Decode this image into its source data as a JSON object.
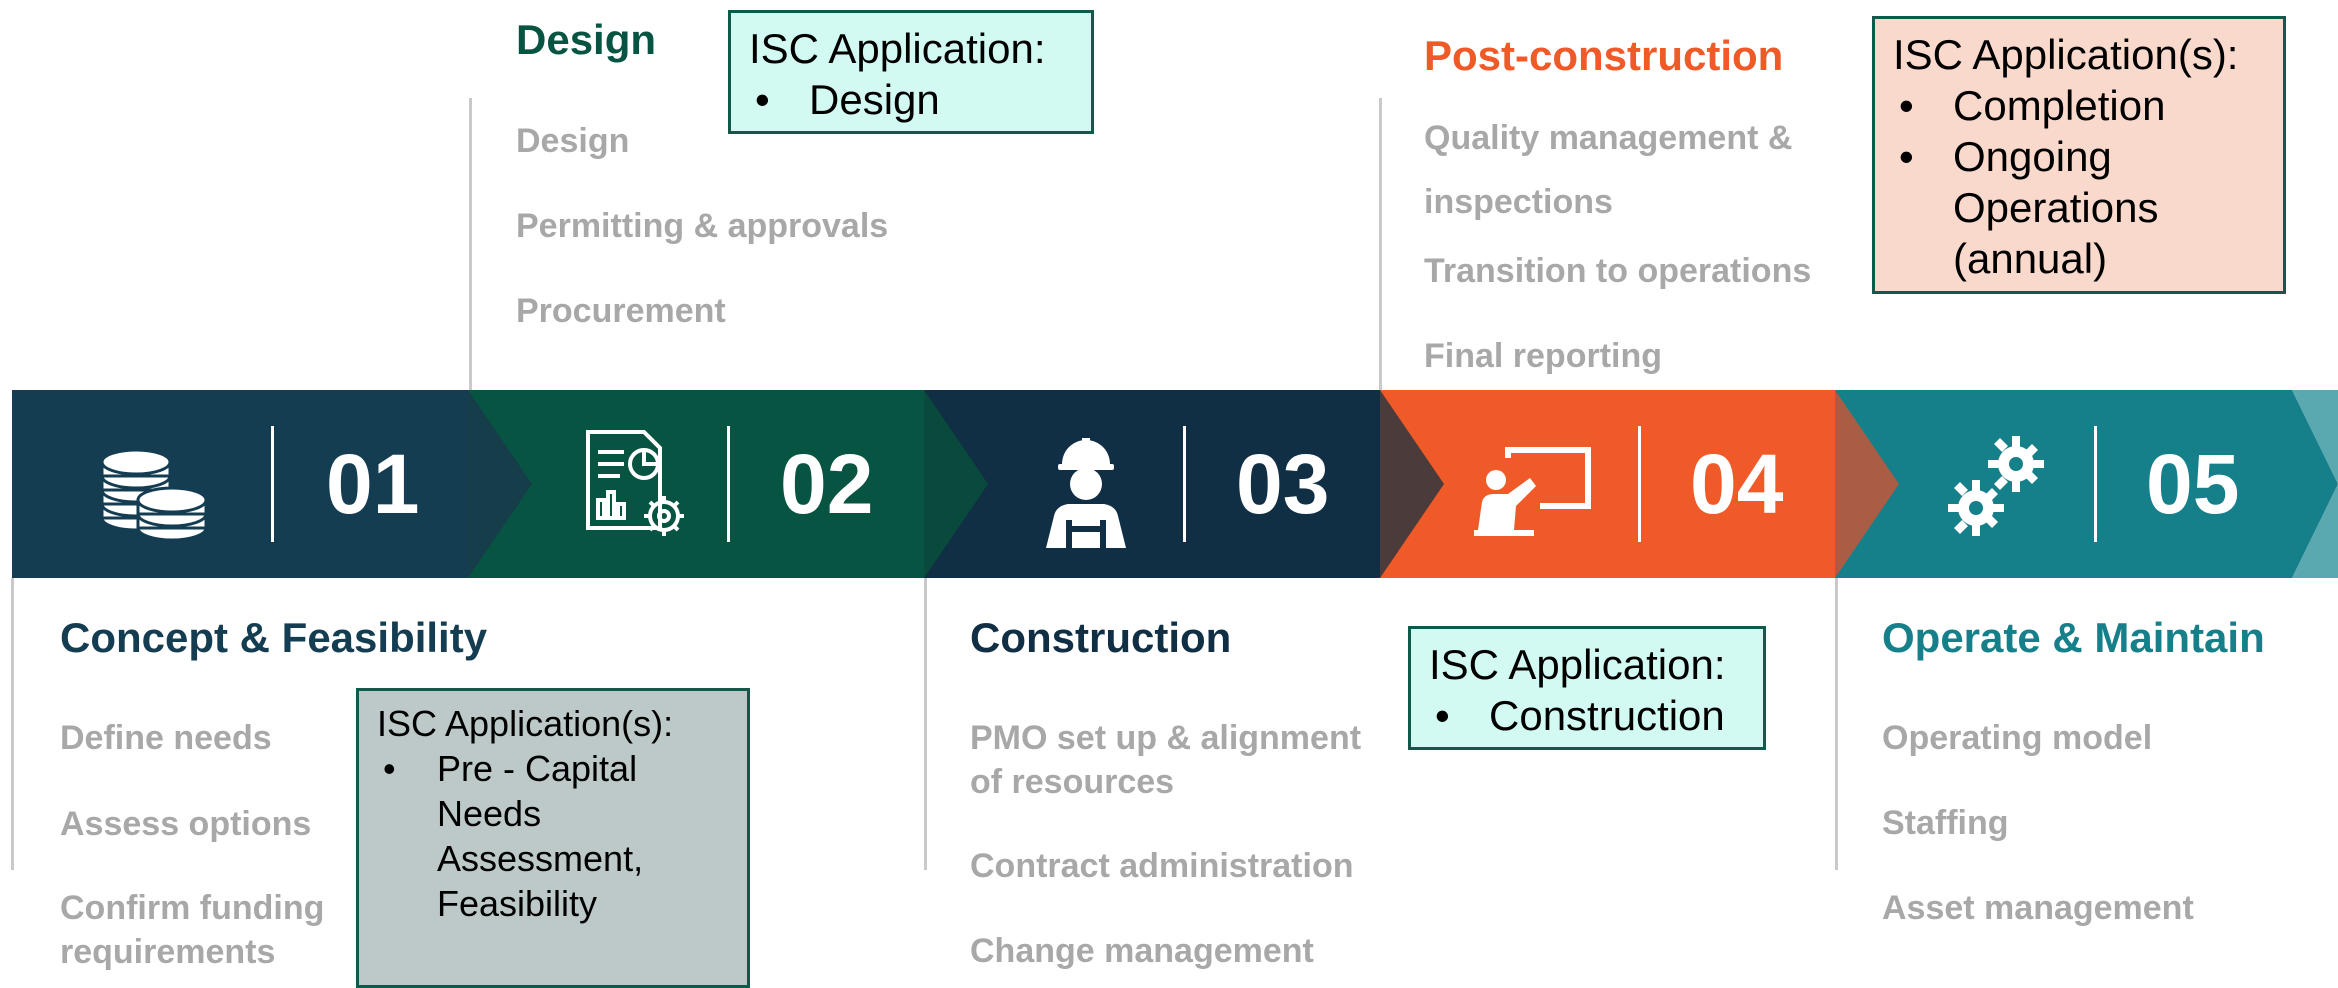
{
  "colors": {
    "phase1": "#153d52",
    "phase2": "#075443",
    "phase3": "#102f45",
    "phase4": "#f05a28",
    "phase5": "#157f8a",
    "item_gray": "#a8a8a8"
  },
  "phases": [
    {
      "number": "01",
      "icon": "coins-icon",
      "title": "Concept & Feasibility",
      "items": [
        "Define needs",
        "Assess options",
        "Confirm funding requirements"
      ]
    },
    {
      "number": "02",
      "icon": "report-gear-icon",
      "title": "Design",
      "items": [
        "Design",
        "Permitting & approvals",
        "Procurement"
      ]
    },
    {
      "number": "03",
      "icon": "construction-worker-icon",
      "title": "Construction",
      "items": [
        "PMO set up & alignment of resources",
        "Contract administration",
        "Change management"
      ]
    },
    {
      "number": "04",
      "icon": "presentation-board-icon",
      "title": "Post-construction",
      "items": [
        "Quality management & inspections",
        "Transition to operations",
        "Final reporting"
      ]
    },
    {
      "number": "05",
      "icon": "gears-icon",
      "title": "Operate & Maintain",
      "items": [
        "Operating model",
        "Staffing",
        "Asset management"
      ]
    }
  ],
  "isc_boxes": {
    "concept": {
      "title": "ISC Application(s):",
      "items": [
        "Pre - Capital Needs Assessment, Feasibility"
      ]
    },
    "design": {
      "title": "ISC Application:",
      "items": [
        "Design"
      ]
    },
    "construction": {
      "title": "ISC Application:",
      "items": [
        "Construction"
      ]
    },
    "post": {
      "title": "ISC Application(s):",
      "items": [
        "Completion",
        "Ongoing Operations (annual)"
      ]
    }
  }
}
